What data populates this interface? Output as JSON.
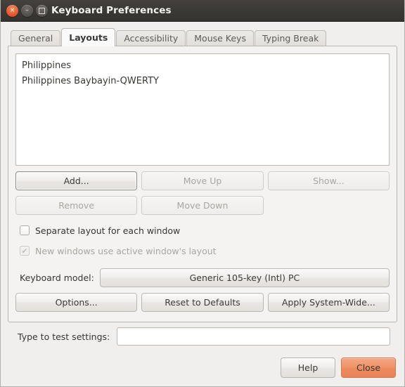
{
  "window": {
    "title": "Keyboard Preferences",
    "controls": {
      "close": "close-button",
      "minimize": "minimize-button",
      "maximize": "maximize-button",
      "close_glyph": "×",
      "minimize_glyph": "–"
    }
  },
  "tabs": [
    {
      "label": "General",
      "active": false
    },
    {
      "label": "Layouts",
      "active": true
    },
    {
      "label": "Accessibility",
      "active": false
    },
    {
      "label": "Mouse Keys",
      "active": false
    },
    {
      "label": "Typing Break",
      "active": false
    }
  ],
  "layouts": {
    "list": [
      {
        "label": "Philippines"
      },
      {
        "label": "Philippines Baybayin-QWERTY"
      }
    ],
    "buttons_row1": [
      {
        "label": "Add...",
        "enabled": true,
        "focused": true
      },
      {
        "label": "Move Up",
        "enabled": false,
        "focused": false
      },
      {
        "label": "Show...",
        "enabled": false,
        "focused": false
      }
    ],
    "buttons_row2": [
      {
        "label": "Remove",
        "enabled": false,
        "focused": false
      },
      {
        "label": "Move Down",
        "enabled": false,
        "focused": false
      }
    ],
    "checkboxes": [
      {
        "label": "Separate layout for each window",
        "checked": false,
        "enabled": true
      },
      {
        "label": "New windows use active window's layout",
        "checked": true,
        "enabled": false
      }
    ],
    "keyboard_model": {
      "label": "Keyboard model:",
      "value": "Generic 105-key (Intl) PC"
    },
    "buttons_row3": [
      {
        "label": "Options...",
        "enabled": true
      },
      {
        "label": "Reset to Defaults",
        "enabled": true
      },
      {
        "label": "Apply System-Wide...",
        "enabled": true
      }
    ]
  },
  "test": {
    "label": "Type to test settings:",
    "value": "",
    "placeholder": ""
  },
  "actions": {
    "help_label": "Help",
    "close_label": "Close"
  },
  "colors": {
    "accent_orange": "#ef9064",
    "titlebar": "#3b3935",
    "window_bg": "#f0efed",
    "panel_bg": "#f4f3f1",
    "list_bg": "#ffffff"
  },
  "checkmark_glyph": "✔"
}
